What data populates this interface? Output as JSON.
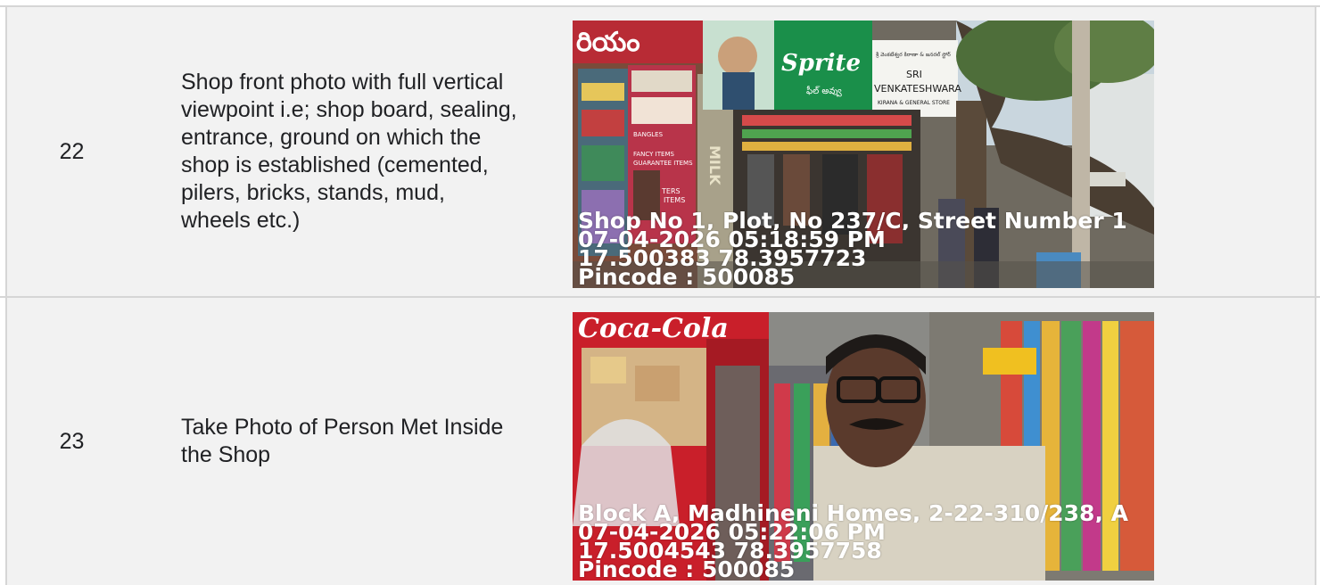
{
  "rows": [
    {
      "number": "22",
      "description": "Shop front photo with full vertical viewpoint i.e; shop board, sealing, entrance, ground on which the shop is established (cemented, pilers, bricks, stands, mud, wheels etc.)",
      "photo": {
        "address": "Shop No 1, Plot, No 237/C, Street Number 1",
        "datetime": "07-04-2026 05:18:59 PM",
        "coordinates": "17.500383 78.3957723",
        "pincode": "Pincode : 500085",
        "signs": {
          "brand": "Sprite",
          "brand_sub": "ఫీల్ అవ్వు",
          "store_telugu": "శ్రీ వెంకటేశ్వర కిరాణా & జనరల్ స్టోర్",
          "store_line1": "SRI",
          "store_line2": "VENKATESHWARA",
          "store_line3": "KIRANA & GENERAL STORE",
          "left_top": "రియం",
          "side_sign_a": "BANGLES",
          "side_sign_b": "FANCY ITEMS",
          "side_sign_c": "GUARANTEE ITEMS",
          "side_sign_d": "TERS",
          "side_sign_e": "ITEMS",
          "pillar": "MILK"
        }
      }
    },
    {
      "number": "23",
      "description": "Take Photo of Person Met Inside the Shop",
      "photo": {
        "address": "Block A, Madhineni Homes, 2-22-310/238, A",
        "datetime": "07-04-2026 05:22:06 PM",
        "coordinates": "17.5004543 78.3957758",
        "pincode": "Pincode : 500085",
        "signs": {
          "fridge_brand": "Coca-Cola"
        }
      }
    }
  ],
  "colors": {
    "row_background": "#f2f2f2",
    "grid_line": "#d6d6d6",
    "text": "#202124",
    "overlay_text": "#ffffff",
    "sprite_green": "#1a8f4a",
    "coke_red": "#d8232a"
  }
}
